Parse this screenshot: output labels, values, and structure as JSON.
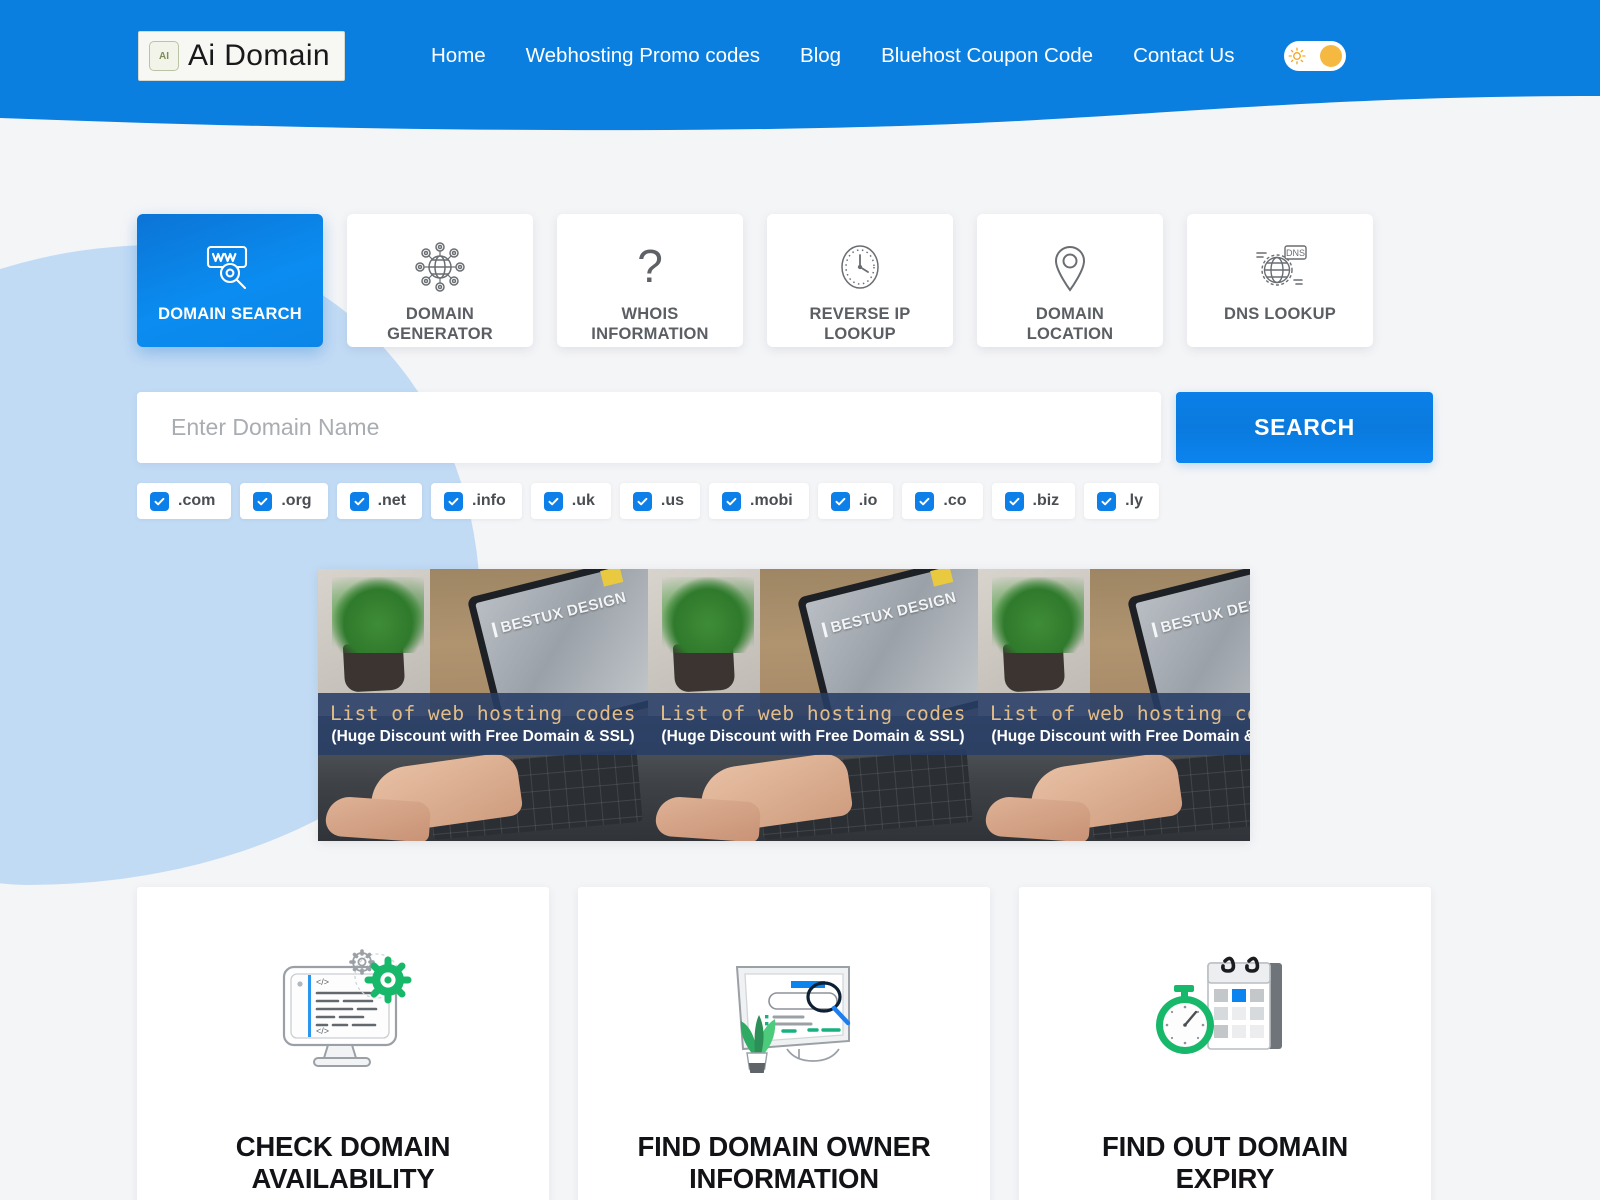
{
  "header": {
    "logo_badge": "AI",
    "logo_text": "Ai Domain",
    "nav": [
      {
        "label": "Home",
        "name": "nav-home"
      },
      {
        "label": "Webhosting Promo codes",
        "name": "nav-webhosting-promo-codes"
      },
      {
        "label": "Blog",
        "name": "nav-blog"
      },
      {
        "label": "Bluehost Coupon Code",
        "name": "nav-bluehost-coupon-code"
      },
      {
        "label": "Contact Us",
        "name": "nav-contact-us"
      }
    ],
    "theme_toggle": {
      "icon": "sun-icon",
      "state": "light"
    },
    "bg_color": "#0a7fe0"
  },
  "tabs": [
    {
      "label": "DOMAIN SEARCH",
      "line1": "DOMAIN SEARCH",
      "line2": "",
      "icon": "www-search-icon",
      "active": true
    },
    {
      "label": "DOMAIN GENERATOR",
      "line1": "DOMAIN",
      "line2": "GENERATOR",
      "icon": "network-globe-icon",
      "active": false
    },
    {
      "label": "WHOIS INFORMATION",
      "line1": "WHOIS",
      "line2": "INFORMATION",
      "icon": "question-mark-icon",
      "active": false
    },
    {
      "label": "REVERSE IP LOOKUP",
      "line1": "REVERSE IP",
      "line2": "LOOKUP",
      "icon": "clock-icon",
      "active": false
    },
    {
      "label": "DOMAIN LOCATION",
      "line1": "DOMAIN",
      "line2": "LOCATION",
      "icon": "map-pin-icon",
      "active": false
    },
    {
      "label": "DNS LOOKUP",
      "line1": "DNS LOOKUP",
      "line2": "",
      "icon": "dns-globe-icon",
      "active": false
    }
  ],
  "search": {
    "placeholder": "Enter Domain Name",
    "value": "",
    "button_label": "SEARCH",
    "button_color": "#0a7fe0"
  },
  "tlds": [
    {
      "label": ".com",
      "checked": true
    },
    {
      "label": ".org",
      "checked": true
    },
    {
      "label": ".net",
      "checked": true
    },
    {
      "label": ".info",
      "checked": true
    },
    {
      "label": ".uk",
      "checked": true
    },
    {
      "label": ".us",
      "checked": true
    },
    {
      "label": ".mobi",
      "checked": true
    },
    {
      "label": ".io",
      "checked": true
    },
    {
      "label": ".co",
      "checked": true
    },
    {
      "label": ".biz",
      "checked": true
    },
    {
      "label": ".ly",
      "checked": true
    }
  ],
  "banner": {
    "title": "List of web hosting codes",
    "subtitle": "(Huge Discount with Free Domain & SSL)",
    "tablet_text": "BESTUX DESIGN",
    "band_color": "#283e67",
    "title_color": "#e3bd87",
    "slides": 3
  },
  "features": [
    {
      "line1": "CHECK DOMAIN",
      "line2": "AVAILABILITY",
      "icon": "monitor-code-gear-icon"
    },
    {
      "line1": "FIND DOMAIN OWNER",
      "line2": "INFORMATION",
      "icon": "monitor-search-plant-icon"
    },
    {
      "line1": "FIND OUT DOMAIN",
      "line2": "EXPIRY",
      "icon": "stopwatch-calendar-icon"
    }
  ],
  "theme": {
    "accent": "#0a7fe0",
    "blob": "#c2dbf5",
    "page_bg": "#f4f5f7",
    "green": "#18b86a"
  }
}
